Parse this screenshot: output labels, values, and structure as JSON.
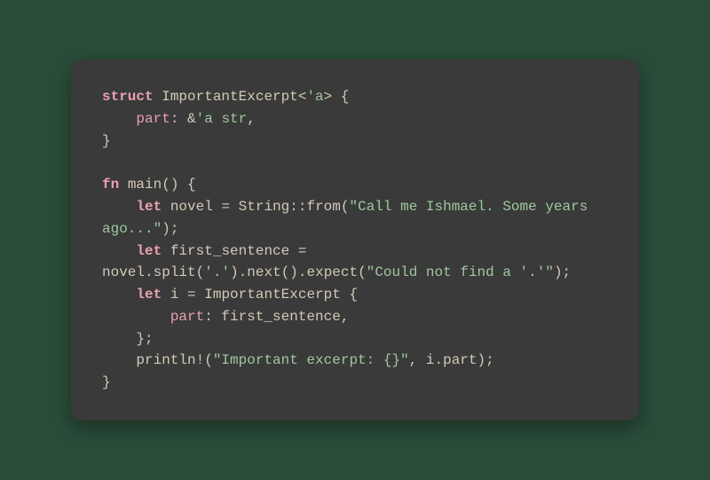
{
  "code": {
    "line1": {
      "kw": "struct",
      "name": "ImportantExcerpt",
      "lt_open": "<",
      "lt": "'a",
      "lt_close": ">",
      "brace": " {"
    },
    "line2": {
      "indent": "    ",
      "field": "part",
      "colon": ": ",
      "amp": "&",
      "lt": "'a",
      "sp": " ",
      "ty": "str",
      "comma": ","
    },
    "line3": {
      "brace": "}"
    },
    "line5": {
      "kw": "fn",
      "sp": " ",
      "name": "main",
      "parens": "()",
      "brace": " {"
    },
    "line6": {
      "indent": "    ",
      "kw": "let",
      "sp": " ",
      "var": "novel",
      "eq": " = ",
      "ty": "String",
      "sep": "::",
      "fn": "from",
      "open": "(",
      "str": "\"Call me Ishmael. Some years ago...\"",
      "close": ");"
    },
    "line7": {
      "indent": "    ",
      "kw": "let",
      "sp": " ",
      "var": "first_sentence",
      "eq": " = "
    },
    "line8": {
      "obj": "novel",
      "d1": ".",
      "m1": "split",
      "p1": "(",
      "s1": "'.'",
      "p1c": ")",
      "d2": ".",
      "m2": "next",
      "p2": "()",
      "d3": ".",
      "m3": "expect",
      "p3": "(",
      "s2": "\"Could not find a '.'\"",
      "p3c": ");"
    },
    "line9": {
      "indent": "    ",
      "kw": "let",
      "sp": " ",
      "var": "i",
      "eq": " = ",
      "ty": "ImportantExcerpt",
      "brace": " {"
    },
    "line10": {
      "indent": "        ",
      "field": "part",
      "colon": ": ",
      "val": "first_sentence",
      "comma": ","
    },
    "line11": {
      "indent": "    ",
      "brace": "};"
    },
    "line12": {
      "indent": "    ",
      "macro": "println!",
      "open": "(",
      "str": "\"Important excerpt: {}\"",
      "comma": ", ",
      "obj": "i",
      "dot": ".",
      "field": "part",
      "close": ");"
    },
    "line13": {
      "brace": "}"
    }
  }
}
